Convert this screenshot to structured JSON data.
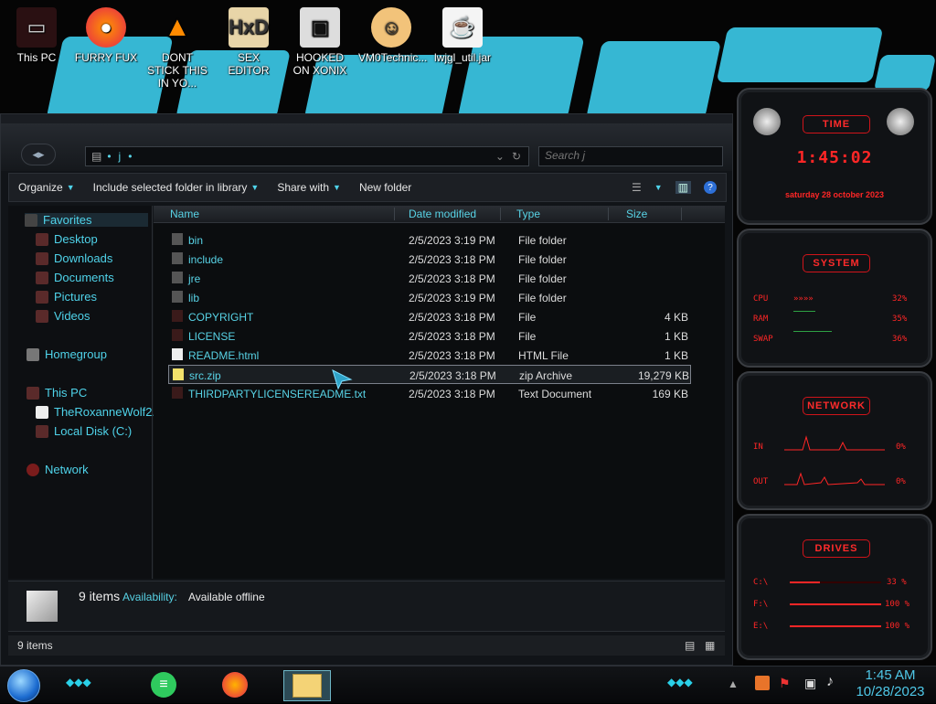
{
  "desktop": {
    "icons": [
      {
        "label": "This PC",
        "icon": "computer-icon"
      },
      {
        "label": "FURRY FUX",
        "icon": "firefox-icon"
      },
      {
        "label": "DONT STICK THIS IN YO...",
        "icon": "vlc-icon"
      },
      {
        "label": "SEX EDITOR",
        "icon": "hxd-editor-icon"
      },
      {
        "label": "HOOKED ON XONIX",
        "icon": "game-icon"
      },
      {
        "label": "VM0Technic...",
        "icon": "doctor-icon"
      },
      {
        "label": "lwjgl_util.jar",
        "icon": "java-icon"
      }
    ]
  },
  "explorer": {
    "address": {
      "crumbs": [
        "j"
      ]
    },
    "search": {
      "placeholder": "Search j"
    },
    "toolbar": {
      "organize": "Organize",
      "include": "Include selected folder in library",
      "share": "Share with",
      "new_folder": "New folder"
    },
    "nav": {
      "favorites": "Favorites",
      "desktop": "Desktop",
      "downloads": "Downloads",
      "documents": "Documents",
      "pictures": "Pictures",
      "videos": "Videos",
      "homegroup": "Homegroup",
      "this_pc": "This PC",
      "user": "TheRoxanneWolf2...",
      "local_disk": "Local Disk (C:)",
      "network": "Network"
    },
    "columns": {
      "name": "Name",
      "date": "Date modified",
      "type": "Type",
      "size": "Size"
    },
    "files": [
      {
        "name": "bin",
        "date": "2/5/2023 3:19 PM",
        "type": "File folder",
        "size": ""
      },
      {
        "name": "include",
        "date": "2/5/2023 3:18 PM",
        "type": "File folder",
        "size": ""
      },
      {
        "name": "jre",
        "date": "2/5/2023 3:18 PM",
        "type": "File folder",
        "size": ""
      },
      {
        "name": "lib",
        "date": "2/5/2023 3:19 PM",
        "type": "File folder",
        "size": ""
      },
      {
        "name": "COPYRIGHT",
        "date": "2/5/2023 3:18 PM",
        "type": "File",
        "size": "4 KB"
      },
      {
        "name": "LICENSE",
        "date": "2/5/2023 3:18 PM",
        "type": "File",
        "size": "1 KB"
      },
      {
        "name": "README.html",
        "date": "2/5/2023 3:18 PM",
        "type": "HTML File",
        "size": "1 KB"
      },
      {
        "name": "src.zip",
        "date": "2/5/2023 3:18 PM",
        "type": "zip Archive",
        "size": "19,279 KB"
      },
      {
        "name": "THIRDPARTYLICENSEREADME.txt",
        "date": "2/5/2023 3:18 PM",
        "type": "Text Document",
        "size": "169 KB"
      }
    ],
    "details": {
      "count": "9 items",
      "availability_label": "Availability:",
      "availability_value": "Available offline"
    },
    "status": {
      "count": "9 items"
    }
  },
  "gadgets": {
    "time": {
      "title": "TIME",
      "clock": "1:45:02",
      "date": "saturday 28 october 2023"
    },
    "system": {
      "title": "SYSTEM",
      "rows": [
        {
          "label": "CPU",
          "value": "32%"
        },
        {
          "label": "RAM",
          "value": "35%"
        },
        {
          "label": "SWAP",
          "value": "36%"
        }
      ]
    },
    "network": {
      "title": "NETWORK",
      "rows": [
        {
          "label": "IN",
          "value": "0%"
        },
        {
          "label": "OUT",
          "value": "0%"
        }
      ]
    },
    "drives": {
      "title": "DRIVES",
      "rows": [
        {
          "label": "C:\\",
          "value": "33 %"
        },
        {
          "label": "F:\\",
          "value": "100 %"
        },
        {
          "label": "E:\\",
          "value": "100 %"
        }
      ]
    }
  },
  "taskbar": {
    "apps": [
      "notes-app-icon",
      "firefox-icon",
      "file-explorer-icon"
    ],
    "tray_icons": [
      "java-update-icon",
      "action-center-icon",
      "network-icon",
      "volume-icon"
    ],
    "time": "1:45 AM",
    "date": "10/28/2023"
  }
}
